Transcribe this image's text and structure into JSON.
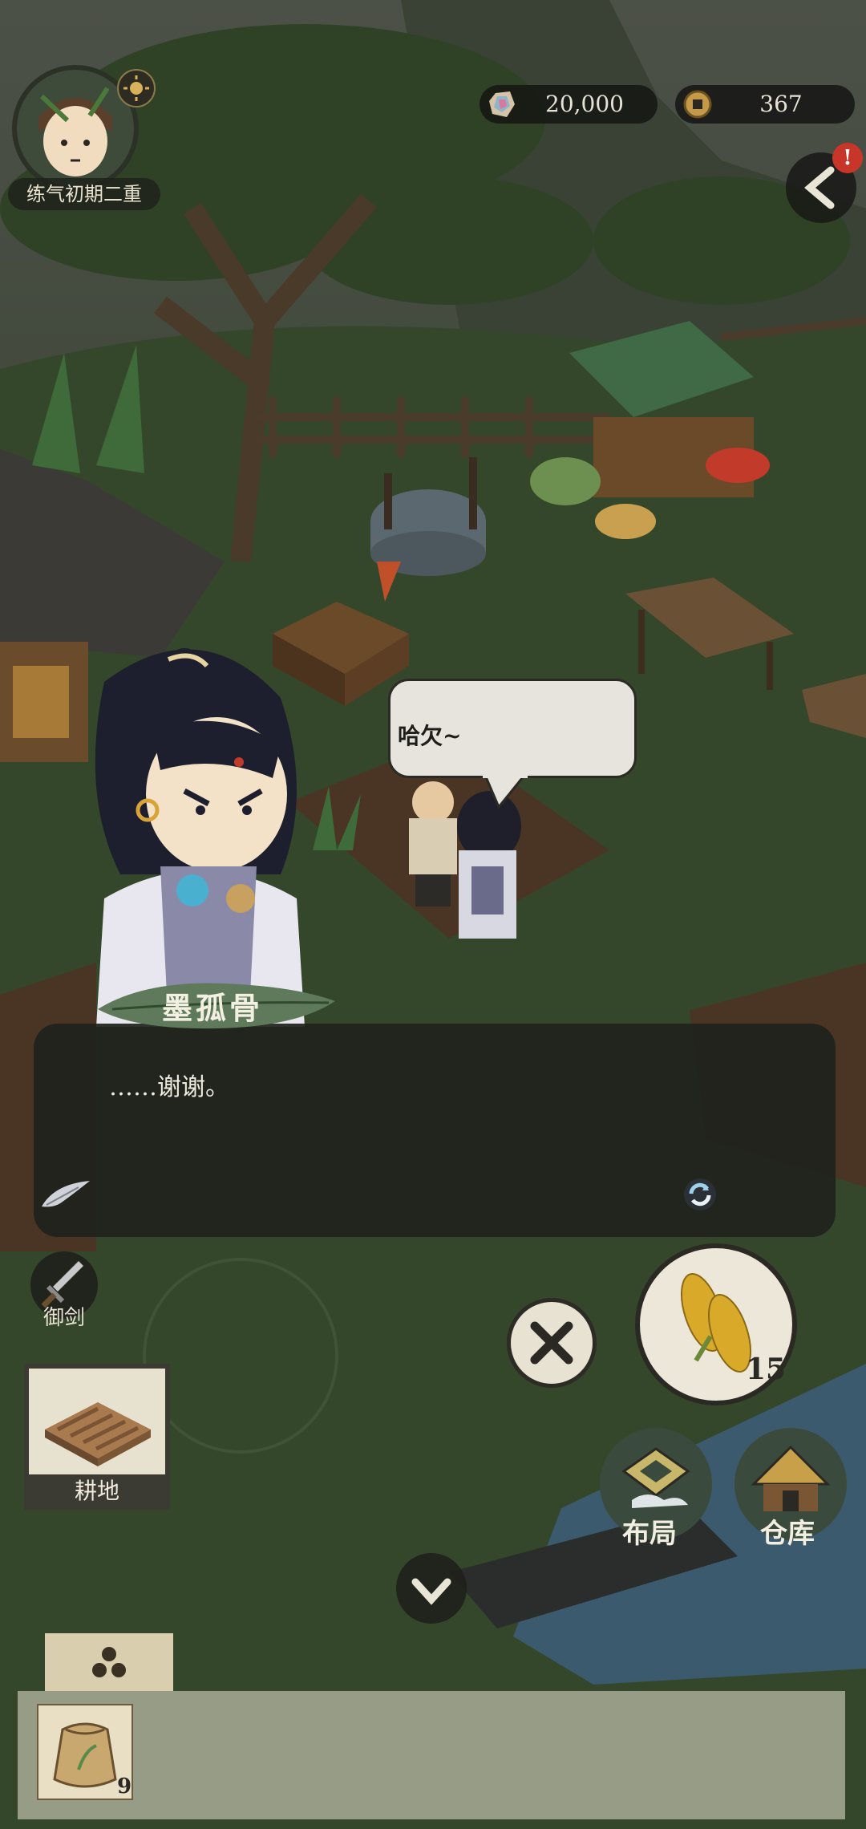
{
  "player": {
    "realm_label": "练气初期二重"
  },
  "resources": {
    "jade": "20,000",
    "coins": "367"
  },
  "alert": {
    "badge": "!"
  },
  "bubble": {
    "text": "哈欠~"
  },
  "dialog": {
    "speaker": "墨孤骨",
    "text": "……谢谢。"
  },
  "controls": {
    "sword_label": "御剑",
    "tile_label": "耕地",
    "seed_count": "15",
    "layout_label": "布局",
    "warehouse_label": "仓库"
  },
  "inventory": {
    "items": [
      {
        "icon": "seed-bag-icon",
        "count": "9"
      }
    ]
  },
  "colors": {
    "dialog_bg": "#20221d",
    "bubble_bg": "#e6e4dc",
    "alert": "#c8362a",
    "card_bg": "#e7e1d0"
  }
}
